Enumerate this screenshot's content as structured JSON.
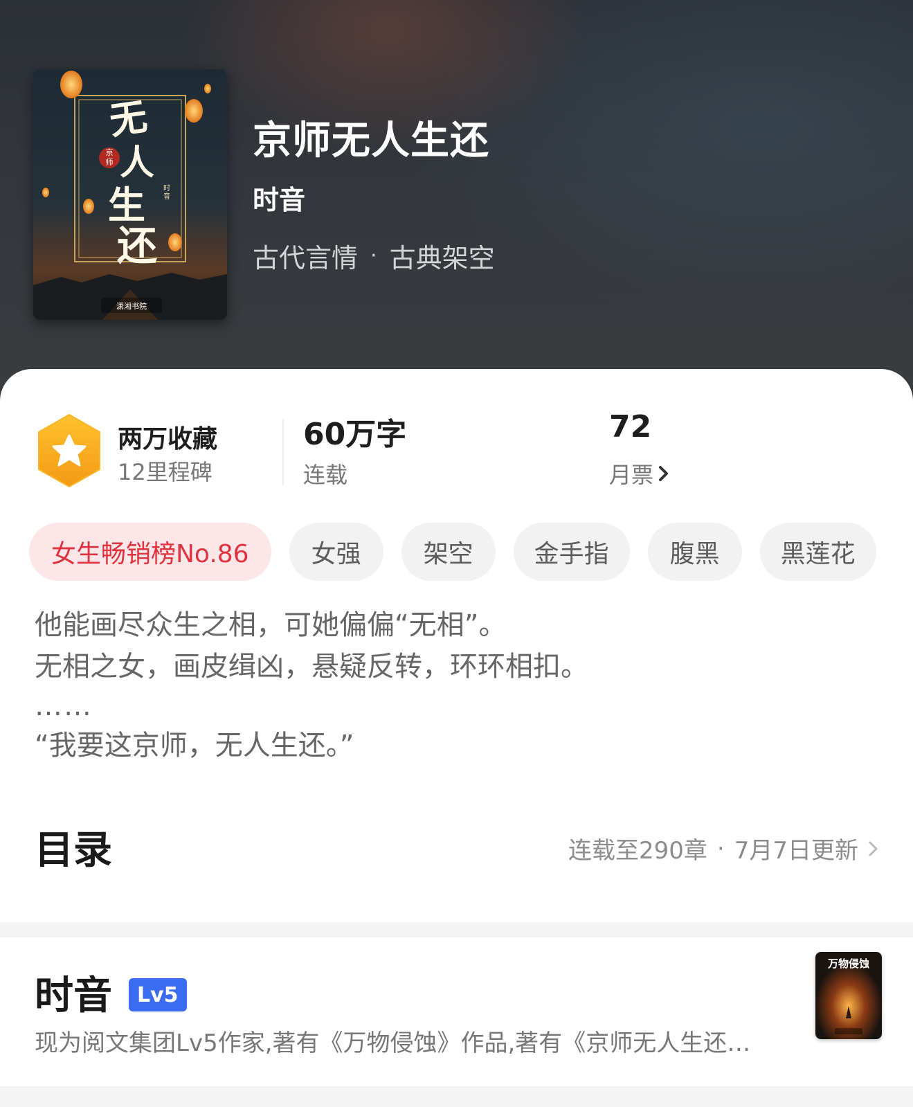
{
  "book": {
    "title": "京师无人生还",
    "author": "时音",
    "genre_main": "古代言情",
    "genre_dot": "·",
    "genre_sub": "古典架空",
    "cover_text": {
      "title": "无人生还",
      "seal": "京师",
      "author": "时音",
      "publisher": "潇湘书院"
    }
  },
  "stats": {
    "favorites": "两万收藏",
    "milestones": "12里程碑",
    "words": "60万字",
    "status": "连载",
    "monthly_tickets": "72",
    "tickets_label": "月票"
  },
  "tags": [
    "女生畅销榜No.86",
    "女强",
    "架空",
    "金手指",
    "腹黑",
    "黑莲花"
  ],
  "synopsis": {
    "line1": "他能画尽众生之相，可她偏偏“无相”。",
    "line2": "无相之女，画皮缉凶，悬疑反转，环环相扣。",
    "line3": "……",
    "line4": "“我要这京师，无人生还。”"
  },
  "toc": {
    "title": "目录",
    "chapters": "连载至290章",
    "sep": "·",
    "updated": "7月7日更新"
  },
  "author": {
    "name": "时音",
    "level": "Lv5",
    "bio": "现为阅文集团Lv5作家,著有《万物侵蚀》作品,著有《京师无人生还…",
    "book_cover_title": "万物侵蚀"
  },
  "colors": {
    "accent_red": "#e0323f",
    "level_blue": "#3a6bf0",
    "star_orange": "#f5a623"
  }
}
